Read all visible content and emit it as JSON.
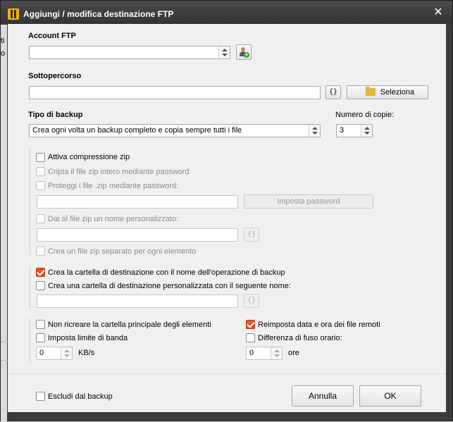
{
  "window": {
    "title": "Aggiungi / modifica destinazione FTP"
  },
  "account": {
    "label": "Account FTP",
    "value": ""
  },
  "subpath": {
    "label": "Sottopercorso",
    "value": "",
    "braces_label": "{}",
    "select_label": "Seleziona"
  },
  "backup_type": {
    "label": "Tipo di backup",
    "value": "Crea ogni volta un backup completo e copia sempre tutti i file",
    "copies_label": "Numero di copie:",
    "copies_value": "3"
  },
  "zip": {
    "compress_label": "Attiva compressione zip",
    "encrypt_label": "Cripta il file zip intero mediante password",
    "protect_label": "Proteggi i file .zip mediante password:",
    "password_button": "Imposta password",
    "custom_name_label": "Dai al file zip un nome personalizzato:",
    "braces_label": "{}",
    "separate_label": "Crea un file zip separato per ogni elemento"
  },
  "destination": {
    "create_folder_label": "Crea la cartella di destinazione con il nome dell'operazione di backup",
    "custom_folder_label": "Crea una cartella di destinazione personalizzata con il seguente nome:",
    "braces_label": "{}"
  },
  "options": {
    "no_recreate_label": "Non ricreare la cartella principale degli elementi",
    "bandwidth_label": "Imposta limite di banda",
    "bandwidth_value": "0",
    "bandwidth_unit": "KB/s",
    "reset_date_label": "Reimposta data e ora dei file remoti",
    "timezone_label": "Differenza di fuso orario:",
    "timezone_value": "0",
    "timezone_unit": "ore"
  },
  "footer": {
    "exclude_label": "Escludi dal backup",
    "cancel_label": "Annulla",
    "ok_label": "OK"
  },
  "background": {
    "text_1": "ti",
    "text_2": "o"
  },
  "colors": {
    "checked": "#e8552a",
    "titlebar": "#3c3c3c",
    "panel": "#f0f0f0"
  }
}
